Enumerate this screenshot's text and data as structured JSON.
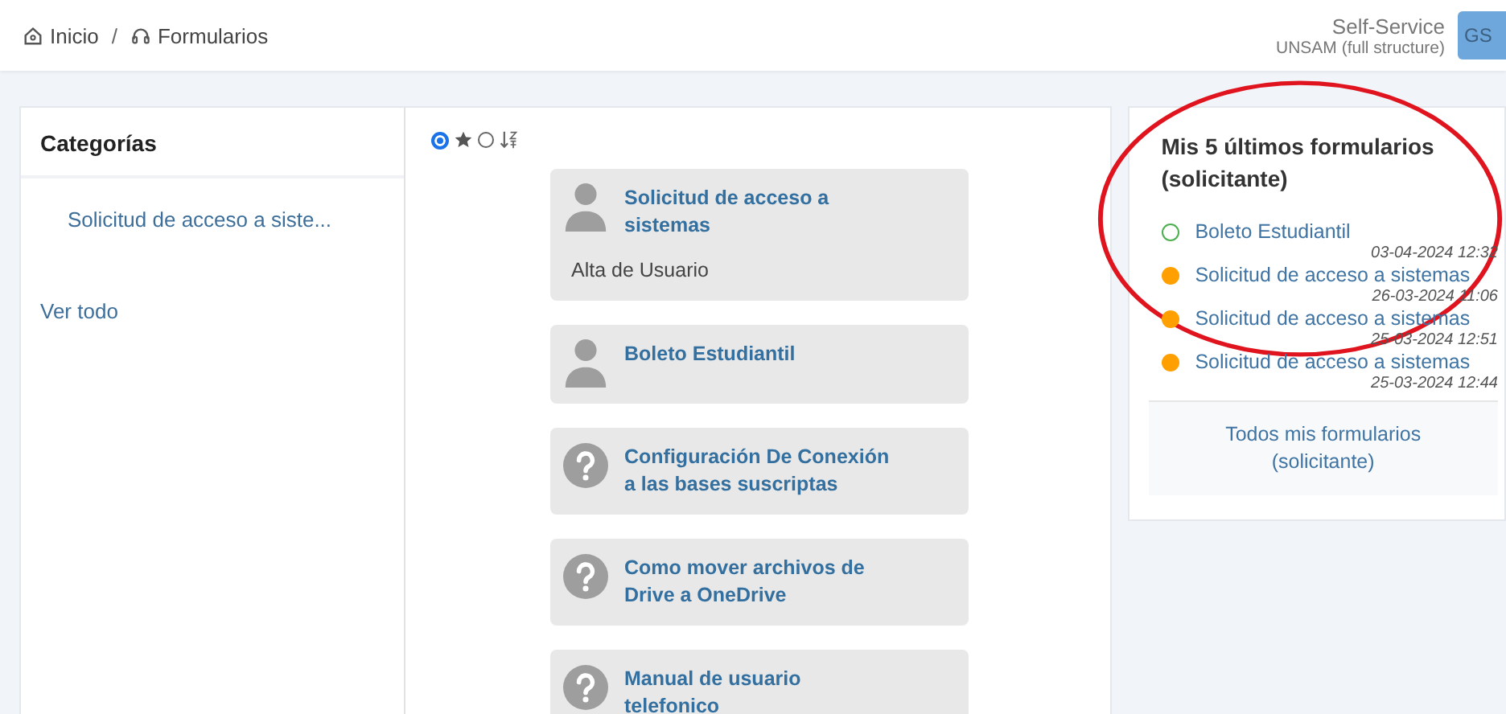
{
  "breadcrumb": [
    {
      "kind": "home",
      "label": "Inicio"
    },
    {
      "kind": "headset",
      "label": "Formularios"
    }
  ],
  "breadcrumb_separator": "/",
  "user": {
    "service": "Self-Service",
    "organization": "UNSAM (full structure)",
    "initials": "GS"
  },
  "categories": {
    "title": "Categorías",
    "items": [
      "Solicitud de acceso a siste..."
    ],
    "see_all": "Ver todo"
  },
  "view_options": [
    {
      "kind": "favorites",
      "selected": true
    },
    {
      "kind": "alphabetical",
      "selected": false
    }
  ],
  "forms": [
    {
      "kind": "person",
      "title": "Solicitud de acceso a sistemas",
      "subtitle": "Alta de Usuario"
    },
    {
      "kind": "person",
      "title": "Boleto Estudiantil"
    },
    {
      "kind": "help",
      "title": "Configuración De Conexión a las bases suscriptas"
    },
    {
      "kind": "help",
      "title": "Como mover archivos de Drive a OneDrive"
    },
    {
      "kind": "help",
      "title": "Manual de usuario telefonico"
    }
  ],
  "recent": {
    "title": "Mis 5 últimos formularios (solicitante)",
    "items": [
      {
        "label": "Boleto Estudiantil",
        "date": "03-04-2024 12:32",
        "kind": "outline",
        "color": "#4caf50"
      },
      {
        "label": "Solicitud de acceso a sistemas",
        "date": "26-03-2024 11:06",
        "kind": "filled",
        "color": "#ffa000"
      },
      {
        "label": "Solicitud de acceso a sistemas",
        "date": "25-03-2024 12:51",
        "kind": "filled",
        "color": "#ffa000"
      },
      {
        "label": "Solicitud de acceso a sistemas",
        "date": "25-03-2024 12:44",
        "kind": "filled",
        "color": "#ffa000"
      }
    ],
    "all_link": "Todos mis formularios (solicitante)"
  },
  "annotation": {
    "kind": "ellipse",
    "color": "#e0141e"
  }
}
